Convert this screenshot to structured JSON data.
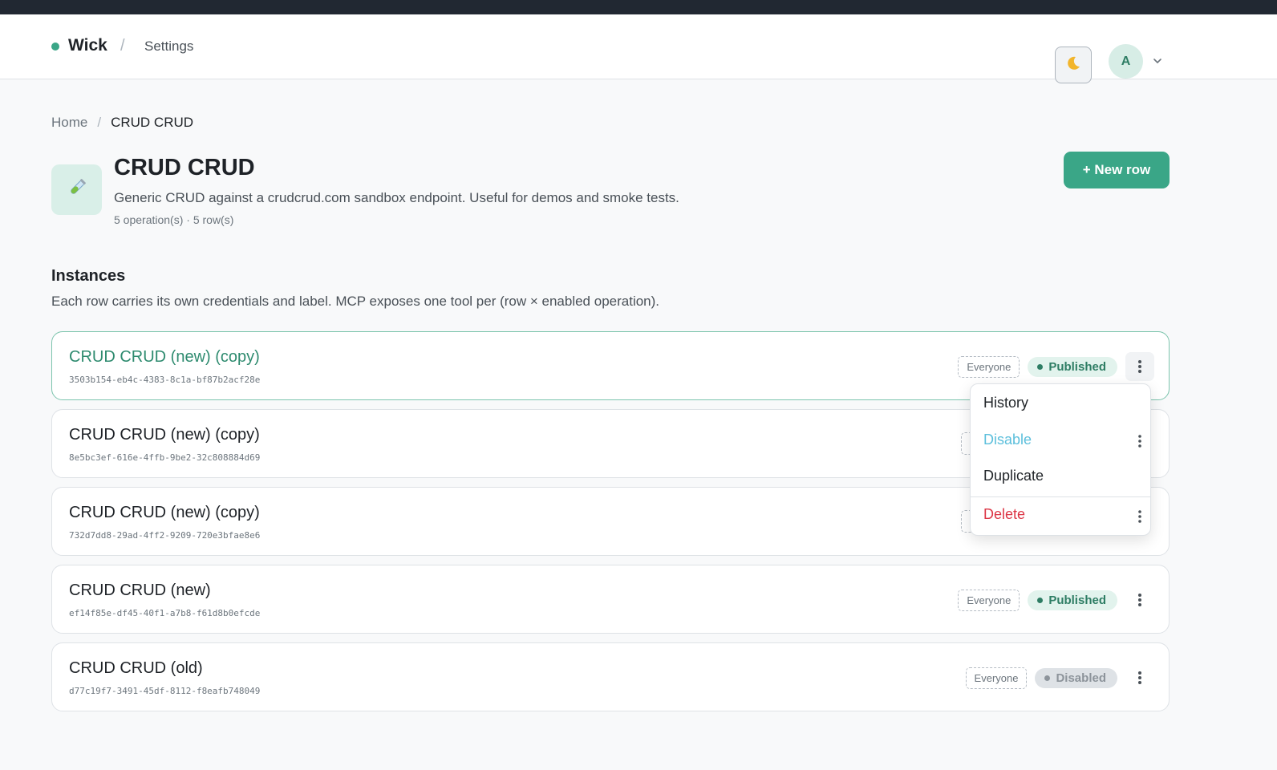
{
  "navbar": {
    "brand": "Wick",
    "separator": "/",
    "section": "Settings",
    "theme_icon": "moon-icon",
    "avatar_initial": "A"
  },
  "breadcrumb": {
    "home": "Home",
    "separator": "/",
    "current": "CRUD CRUD"
  },
  "header": {
    "icon": "test-tube-icon",
    "title": "CRUD CRUD",
    "description": "Generic CRUD against a crudcrud.com sandbox endpoint. Useful for demos and smoke tests.",
    "meta": "5 operation(s) · 5 row(s)",
    "new_row_label": "+ New row"
  },
  "instances": {
    "title": "Instances",
    "description": "Each row carries its own credentials and label. MCP exposes one tool per (row × enabled operation).",
    "rows": [
      {
        "name": "CRUD CRUD (new) (copy)",
        "id": "3503b154-eb4c-4383-8c1a-bf87b2acf28e",
        "audience": "Everyone",
        "status": "Published"
      },
      {
        "name": "CRUD CRUD (new) (copy)",
        "id": "8e5bc3ef-616e-4ffb-9be2-32c808884d69",
        "audience": "",
        "status": ""
      },
      {
        "name": "CRUD CRUD (new) (copy)",
        "id": "732d7dd8-29ad-4ff2-9209-720e3bfae8e6",
        "audience": "",
        "status": ""
      },
      {
        "name": "CRUD CRUD (new)",
        "id": "ef14f85e-df45-40f1-a7b8-f61d8b0efcde",
        "audience": "Everyone",
        "status": "Published"
      },
      {
        "name": "CRUD CRUD (old)",
        "id": "d77c19f7-3491-45df-8112-f8eafb748049",
        "audience": "Everyone",
        "status": "Disabled"
      }
    ]
  },
  "menu": {
    "history": "History",
    "disable": "Disable",
    "duplicate": "Duplicate",
    "delete": "Delete"
  },
  "colors": {
    "accent": "#3aa687",
    "published_bg": "#e2f3ed",
    "disabled_bg": "#dee2e6",
    "delete": "#dc3545",
    "disable_link": "#5cbfdc"
  }
}
